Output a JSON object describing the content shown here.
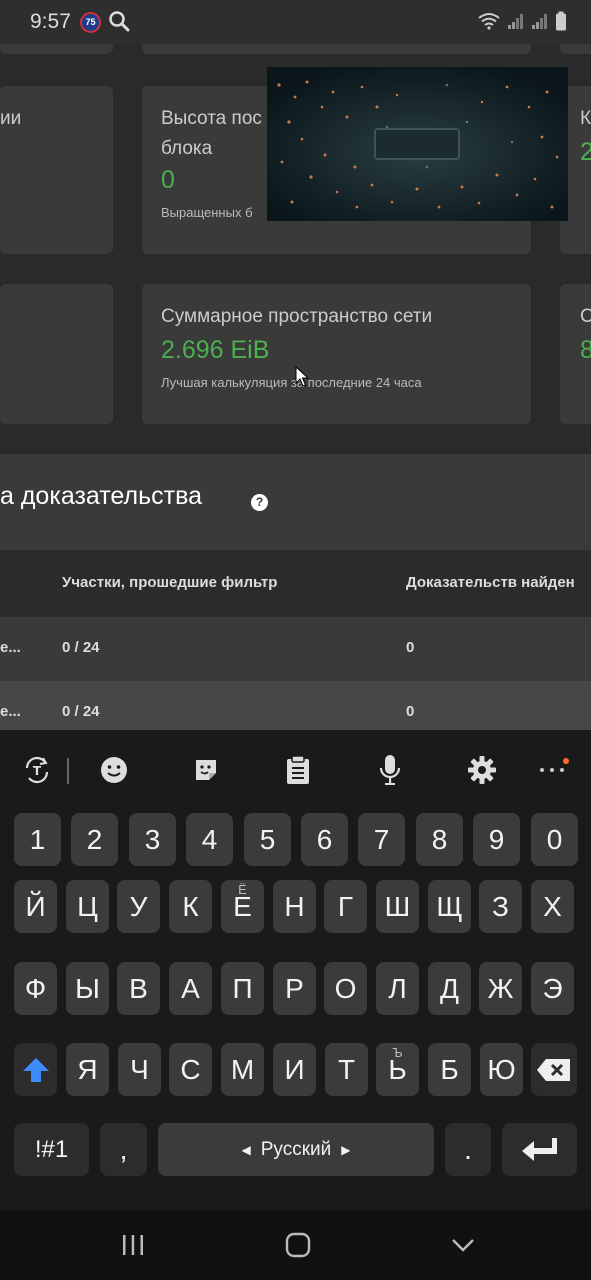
{
  "status_bar": {
    "time": "9:57",
    "badge": "75",
    "icons": [
      "search-icon",
      "wifi-icon",
      "signal-icon",
      "signal-icon",
      "battery-icon"
    ]
  },
  "cards": {
    "row1_left_title": "ии",
    "height_title_line1": "Высота пос",
    "height_title_line2": "блока",
    "height_value": "0",
    "height_sub": "Выращенных б",
    "row1_right_title": "К",
    "row1_right_value": "2",
    "netspace_title": "Суммарное пространство сети",
    "netspace_value": "2.696 EiB",
    "netspace_sub": "Лучшая калькуляция за последние 24 часа",
    "row2_right_title": "С",
    "row2_right_value": "8"
  },
  "section": {
    "title": "а доказательства"
  },
  "table": {
    "headers": [
      "Участки, прошедшие фильтр",
      "Доказательств найден"
    ],
    "rows": [
      {
        "c0": "е...",
        "c1": "0 / 24",
        "c2": "0"
      },
      {
        "c0": "е...",
        "c1": "0 / 24",
        "c2": "0"
      }
    ]
  },
  "keyboard": {
    "toolbar_icons": [
      "text-mode-icon",
      "emoji-icon",
      "sticker-icon",
      "clipboard-icon",
      "microphone-icon",
      "settings-icon",
      "more-icon"
    ],
    "row_digits": [
      "1",
      "2",
      "3",
      "4",
      "5",
      "6",
      "7",
      "8",
      "9",
      "0"
    ],
    "row1": [
      "Й",
      "Ц",
      "У",
      "К",
      "Е",
      "Н",
      "Г",
      "Ш",
      "Щ",
      "З",
      "Х"
    ],
    "row1_hint": "Ё",
    "row2": [
      "Ф",
      "Ы",
      "В",
      "А",
      "П",
      "Р",
      "О",
      "Л",
      "Д",
      "Ж",
      "Э"
    ],
    "row3": [
      "Я",
      "Ч",
      "С",
      "М",
      "И",
      "Т",
      "Ь",
      "Б",
      "Ю"
    ],
    "row3_hint": "Ъ",
    "symbols_label": "!#1",
    "comma_label": ",",
    "space_label": "Русский",
    "period_label": ".",
    "accent_color": "#3d8bfd"
  },
  "navbar": {
    "icons": [
      "recents-icon",
      "home-icon",
      "back-icon"
    ]
  }
}
